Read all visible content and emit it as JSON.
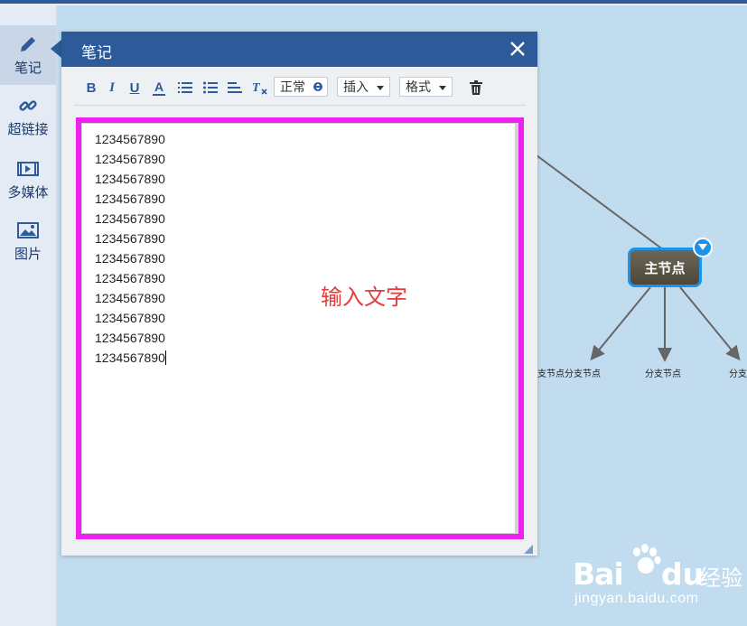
{
  "sidebar": {
    "items": [
      {
        "label": "笔记",
        "icon": "pencil-icon",
        "active": true
      },
      {
        "label": "超链接",
        "icon": "link-icon",
        "active": false
      },
      {
        "label": "多媒体",
        "icon": "film-icon",
        "active": false
      },
      {
        "label": "图片",
        "icon": "image-icon",
        "active": false
      }
    ]
  },
  "mindmap": {
    "main_node": "主节点",
    "branches": [
      "支节点分支节点",
      "分支节点",
      "分支"
    ]
  },
  "note_panel": {
    "title": "笔记",
    "toolbar": {
      "bold": "B",
      "italic": "I",
      "underline": "U",
      "font_color": "A",
      "heading_select": "正常",
      "insert_select": "插入",
      "format_select": "格式"
    },
    "editor_lines": [
      "1234567890",
      "1234567890",
      "1234567890",
      "1234567890",
      "1234567890",
      "1234567890",
      "1234567890",
      "1234567890",
      "1234567890",
      "1234567890",
      "1234567890",
      "1234567890"
    ],
    "annotation": "输入文字"
  },
  "watermark": {
    "brand_left": "Bai",
    "brand_right": "du",
    "product": "经验",
    "url": "jingyan.baidu.com"
  },
  "colors": {
    "header": "#2d5a98",
    "canvas": "#c2dcef",
    "highlight": "#ee22ee",
    "annotation": "#e53a3a",
    "node_border": "#1994e8"
  }
}
